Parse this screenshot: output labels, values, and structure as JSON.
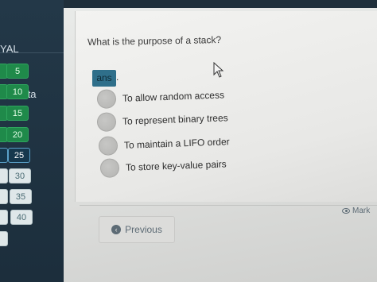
{
  "sidebar": {
    "title_line1": "YAL",
    "title_line2": "nd Data",
    "questions": [
      {
        "label": "5",
        "state": "answered"
      },
      {
        "label": "10",
        "state": "answered"
      },
      {
        "label": "15",
        "state": "answered"
      },
      {
        "label": "20",
        "state": "answered"
      },
      {
        "label": "25",
        "state": "current"
      },
      {
        "label": "30",
        "state": "pending"
      },
      {
        "label": "35",
        "state": "pending"
      },
      {
        "label": "40",
        "state": "pending"
      }
    ]
  },
  "question": {
    "text": "What is the purpose of a stack?",
    "answer_badge": "ans",
    "options": [
      "To allow random access",
      "To represent binary trees",
      "To maintain a LIFO order",
      "To store key-value pairs"
    ]
  },
  "footer": {
    "previous_label": "Previous",
    "mark_label": "Mark"
  },
  "icons": {
    "previous": "chevron-left-circle-icon",
    "mark": "eye-icon",
    "cursor": "mouse-pointer-icon"
  },
  "colors": {
    "answered": "#1f8a4a",
    "current": "#16384d",
    "accent": "#2f6f8a"
  }
}
